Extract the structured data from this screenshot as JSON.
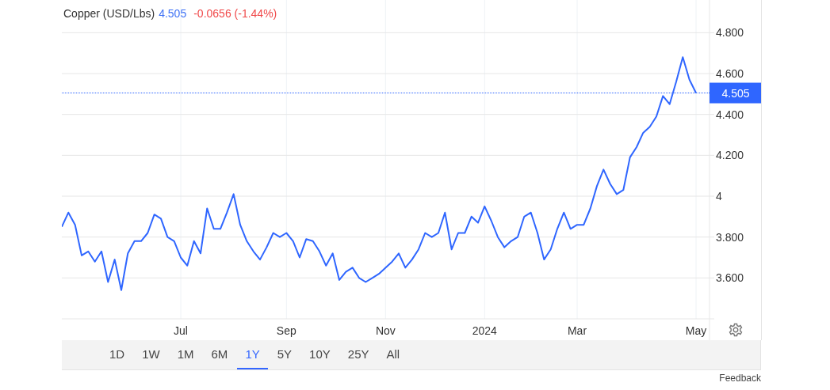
{
  "header": {
    "name": "Copper (USD/Lbs)",
    "price": "4.505",
    "change": "-0.0656 (-1.44%)"
  },
  "chart": {
    "price_tag": "4.505",
    "chart_data": {
      "type": "line",
      "grid": true,
      "ref_lines": [
        {
          "axis": "y",
          "value": 4.505,
          "color": "#2f66ff"
        }
      ],
      "ylim": [
        3.4,
        4.96
      ],
      "categories": [
        null,
        null,
        null,
        null,
        null,
        null,
        null,
        null,
        null,
        null,
        null,
        null,
        null,
        null,
        null,
        null,
        null,
        null,
        "Jul",
        null,
        null,
        null,
        null,
        null,
        null,
        null,
        null,
        null,
        null,
        null,
        null,
        null,
        null,
        null,
        "Sep",
        null,
        null,
        null,
        null,
        null,
        null,
        null,
        null,
        null,
        null,
        null,
        null,
        null,
        null,
        "Nov",
        null,
        null,
        null,
        null,
        null,
        null,
        null,
        null,
        null,
        null,
        null,
        null,
        null,
        null,
        "2024",
        null,
        null,
        null,
        null,
        null,
        null,
        null,
        null,
        null,
        null,
        null,
        null,
        null,
        "Mar",
        null,
        null,
        null,
        null,
        null,
        null,
        null,
        null,
        null,
        null,
        null,
        null,
        null,
        null,
        null,
        null,
        null,
        "May"
      ],
      "yticks": [
        {
          "value": 3.6,
          "label": "3.600"
        },
        {
          "value": 3.8,
          "label": "3.800"
        },
        {
          "value": 4,
          "label": "4"
        },
        {
          "value": 4.2,
          "label": "4.200"
        },
        {
          "value": 4.4,
          "label": "4.400"
        },
        {
          "value": 4.6,
          "label": "4.600"
        },
        {
          "value": 4.8,
          "label": "4.800"
        }
      ],
      "series": [
        {
          "color": "#2f66ff",
          "values": [
            3.85,
            3.92,
            3.86,
            3.71,
            3.73,
            3.68,
            3.73,
            3.58,
            3.69,
            3.54,
            3.72,
            3.78,
            3.78,
            3.82,
            3.91,
            3.89,
            3.8,
            3.78,
            3.7,
            3.66,
            3.78,
            3.72,
            3.94,
            3.84,
            3.84,
            3.92,
            4.01,
            3.86,
            3.78,
            3.73,
            3.69,
            3.75,
            3.82,
            3.8,
            3.82,
            3.78,
            3.7,
            3.79,
            3.78,
            3.73,
            3.66,
            3.72,
            3.59,
            3.63,
            3.65,
            3.6,
            3.58,
            3.6,
            3.62,
            3.65,
            3.68,
            3.72,
            3.65,
            3.69,
            3.74,
            3.82,
            3.8,
            3.82,
            3.92,
            3.74,
            3.82,
            3.82,
            3.9,
            3.87,
            3.95,
            3.88,
            3.8,
            3.75,
            3.78,
            3.8,
            3.9,
            3.92,
            3.82,
            3.69,
            3.74,
            3.84,
            3.92,
            3.84,
            3.86,
            3.86,
            3.94,
            4.05,
            4.13,
            4.06,
            4.01,
            4.03,
            4.19,
            4.24,
            4.31,
            4.34,
            4.39,
            4.49,
            4.45,
            4.56,
            4.68,
            4.57,
            4.505
          ]
        }
      ]
    }
  },
  "ranges": [
    {
      "label": "1D",
      "selected": false
    },
    {
      "label": "1W",
      "selected": false
    },
    {
      "label": "1M",
      "selected": false
    },
    {
      "label": "6M",
      "selected": false
    },
    {
      "label": "1Y",
      "selected": true
    },
    {
      "label": "5Y",
      "selected": false
    },
    {
      "label": "10Y",
      "selected": false
    },
    {
      "label": "25Y",
      "selected": false
    },
    {
      "label": "All",
      "selected": false
    }
  ],
  "feedback": "Feedback"
}
